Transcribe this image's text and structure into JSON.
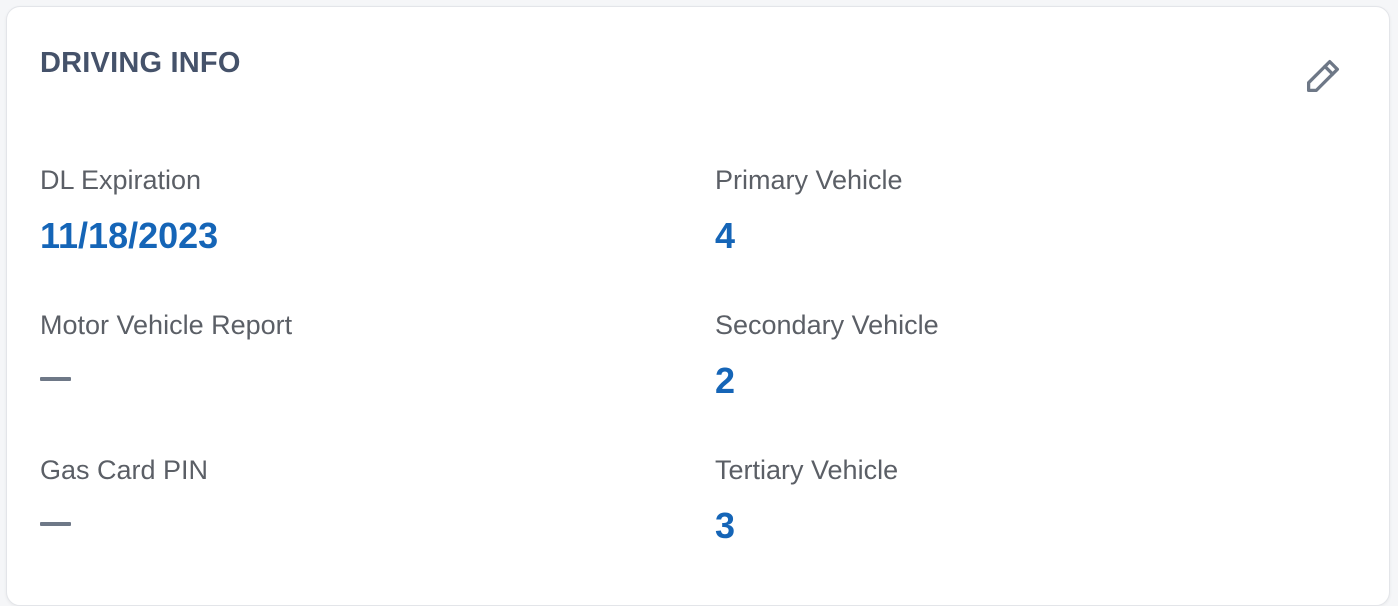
{
  "card": {
    "title": "DRIVING INFO",
    "edit_icon": "pencil-icon"
  },
  "fields": {
    "dl_expiration": {
      "label": "DL Expiration",
      "value": "11/18/2023"
    },
    "motor_vehicle_report": {
      "label": "Motor Vehicle Report",
      "value": null,
      "empty_indicator": "dash"
    },
    "gas_card_pin": {
      "label": "Gas Card PIN",
      "value": null,
      "empty_indicator": "dash"
    },
    "primary_vehicle": {
      "label": "Primary Vehicle",
      "value": "4"
    },
    "secondary_vehicle": {
      "label": "Secondary Vehicle",
      "value": "2"
    },
    "tertiary_vehicle": {
      "label": "Tertiary Vehicle",
      "value": "3"
    }
  },
  "colors": {
    "title": "#45526a",
    "label": "#5b5f66",
    "value_link": "#1565b7",
    "empty_dash": "#6e7887",
    "icon": "#6e7887"
  }
}
